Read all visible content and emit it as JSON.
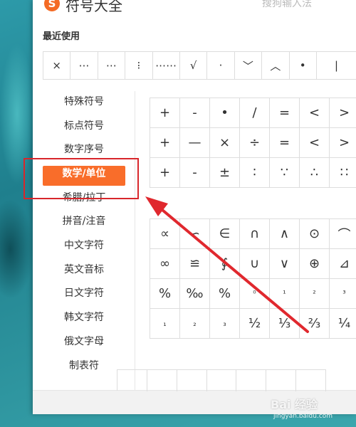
{
  "window": {
    "logo_letter": "S",
    "title": "符号大全",
    "ime_name": "搜狗输入法"
  },
  "recent": {
    "label": "最近使用",
    "symbols": [
      "×",
      "⋯",
      "⋯",
      "⁝",
      "⋯⋯",
      "√",
      "·",
      "﹀",
      "︿",
      "•",
      "❘"
    ]
  },
  "sidebar": {
    "items": [
      "特殊符号",
      "标点符号",
      "数字序号",
      "数学/单位",
      "希腊/拉丁",
      "拼音/注音",
      "中文字符",
      "英文音标",
      "日文字符",
      "韩文字符",
      "俄文字母",
      "制表符"
    ],
    "active_index": 3
  },
  "grid": {
    "block1": [
      "+",
      "-",
      "•",
      "/",
      "=",
      "<",
      ">",
      "+",
      "—",
      "×",
      "÷",
      "=",
      "<",
      ">",
      "+",
      "-",
      "±",
      "∶",
      "∵",
      "∴",
      "∷"
    ],
    "block2": [
      "∝",
      "∽",
      "∈",
      "∩",
      "∧",
      "⊙",
      "⌒",
      "∞",
      "≌",
      "∮",
      "∪",
      "∨",
      "⊕",
      "⊿",
      "%",
      "‰",
      "%",
      "⁰",
      "¹",
      "²",
      "³",
      "₁",
      "₂",
      "₃",
      "½",
      "⅓",
      "⅔",
      "¼"
    ]
  },
  "watermark": {
    "brand": "Bai 经验",
    "url": "jingyan.baidu.com"
  },
  "colors": {
    "accent": "#f96d2a",
    "highlight": "#d8262b"
  }
}
